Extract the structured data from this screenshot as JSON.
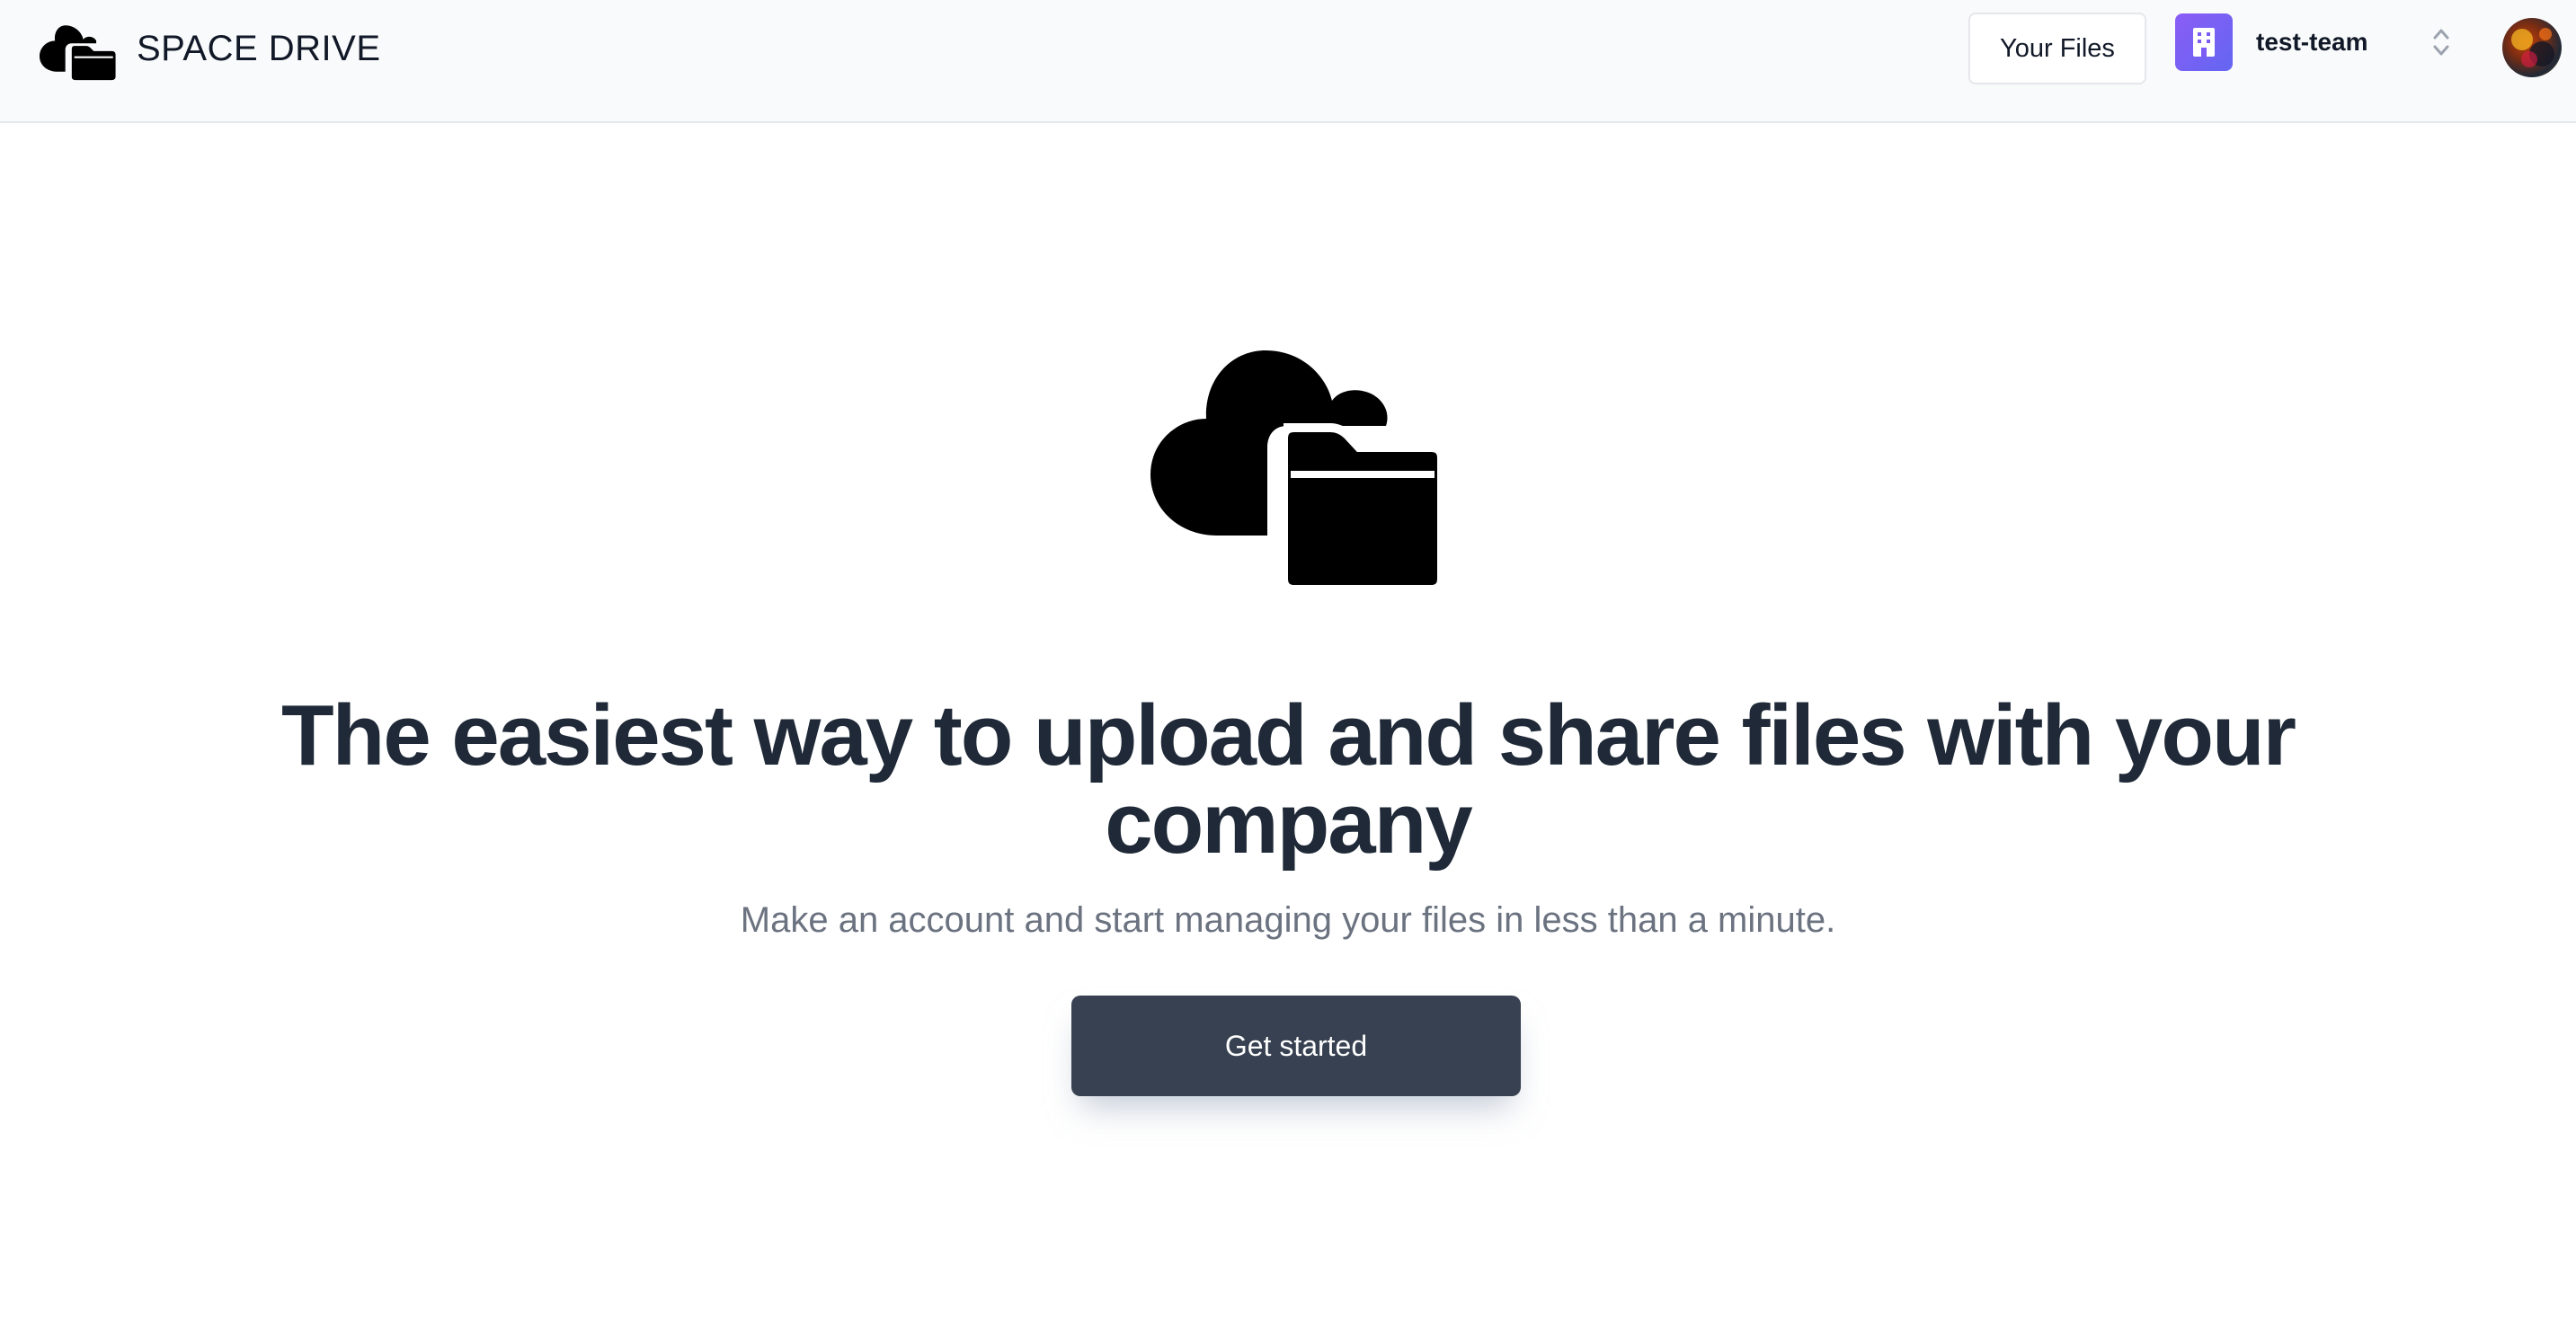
{
  "header": {
    "brand_name": "SPACE DRIVE",
    "your_files_label": "Your Files",
    "team_name": "test-team",
    "team_badge_color": "#7c5cf5"
  },
  "hero": {
    "headline_line1": "The easiest way to upload and share files with your",
    "headline_line2": "company",
    "subtitle": "Make an account and start managing your files in less than a minute.",
    "cta_label": "Get started"
  },
  "icons": {
    "brand": "cloud-folder-icon",
    "team": "building-icon",
    "switcher": "chevron-up-down-icon"
  },
  "colors": {
    "header_bg": "#f9fafb",
    "headline": "#1f2937",
    "subtitle": "#6b7280",
    "cta_bg": "#374151"
  }
}
